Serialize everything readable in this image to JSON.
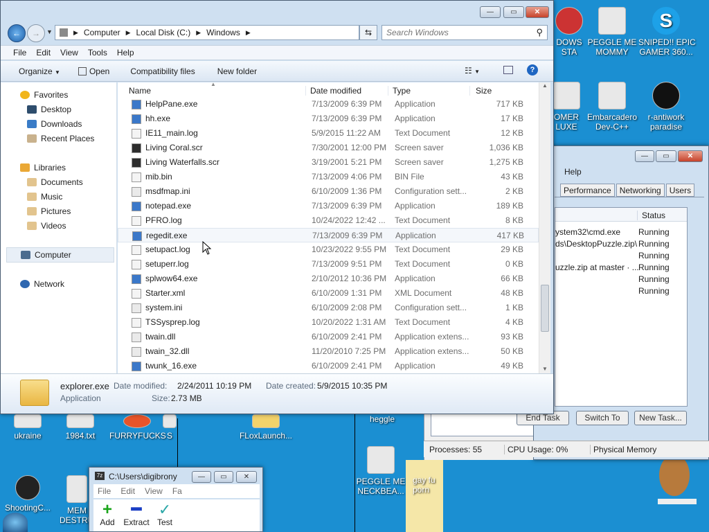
{
  "desktop": {
    "icons": [
      {
        "label": "DOWS\nSTA"
      },
      {
        "label": "PEGGLE ME\nMOMMY"
      },
      {
        "label": "SNIPED!! EPIC\nGAMER 360..."
      },
      {
        "label": "OMER\nLUXE"
      },
      {
        "label": "Embarcadero\nDev-C++"
      },
      {
        "label": "r-antiwork\nparadise"
      },
      {
        "label": "ukraine"
      },
      {
        "label": "1984.txt"
      },
      {
        "label": "FURRYFUCKS"
      },
      {
        "label": "S"
      },
      {
        "label": "FLoxLaunch..."
      },
      {
        "label": "heggle"
      },
      {
        "label": "PEGGLE ME\nNECKBEA..."
      },
      {
        "label": "gay fu\nporn"
      },
      {
        "label": "ShootingC..."
      },
      {
        "label": "MEM\nDESTRUC"
      }
    ]
  },
  "explorer": {
    "address": {
      "crumbs": [
        "Computer",
        "Local Disk (C:)",
        "Windows"
      ]
    },
    "search": {
      "placeholder": "Search Windows"
    },
    "menu": [
      "File",
      "Edit",
      "View",
      "Tools",
      "Help"
    ],
    "toolbar": {
      "organize": "Organize",
      "open": "Open",
      "compat": "Compatibility files",
      "newfolder": "New folder"
    },
    "nav": {
      "favorites": "Favorites",
      "desktop": "Desktop",
      "downloads": "Downloads",
      "recent": "Recent Places",
      "libraries": "Libraries",
      "documents": "Documents",
      "music": "Music",
      "pictures": "Pictures",
      "videos": "Videos",
      "computer": "Computer",
      "network": "Network"
    },
    "columns": {
      "name": "Name",
      "date": "Date modified",
      "type": "Type",
      "size": "Size"
    },
    "files": [
      {
        "name": "HelpPane.exe",
        "date": "7/13/2009 6:39 PM",
        "type": "Application",
        "size": "717 KB"
      },
      {
        "name": "hh.exe",
        "date": "7/13/2009 6:39 PM",
        "type": "Application",
        "size": "17 KB"
      },
      {
        "name": "IE11_main.log",
        "date": "5/9/2015 11:22 AM",
        "type": "Text Document",
        "size": "12 KB"
      },
      {
        "name": "Living Coral.scr",
        "date": "7/30/2001 12:00 PM",
        "type": "Screen saver",
        "size": "1,036 KB"
      },
      {
        "name": "Living Waterfalls.scr",
        "date": "3/19/2001 5:21 PM",
        "type": "Screen saver",
        "size": "1,275 KB"
      },
      {
        "name": "mib.bin",
        "date": "7/13/2009 4:06 PM",
        "type": "BIN File",
        "size": "43 KB"
      },
      {
        "name": "msdfmap.ini",
        "date": "6/10/2009 1:36 PM",
        "type": "Configuration sett...",
        "size": "2 KB"
      },
      {
        "name": "notepad.exe",
        "date": "7/13/2009 6:39 PM",
        "type": "Application",
        "size": "189 KB"
      },
      {
        "name": "PFRO.log",
        "date": "10/24/2022 12:42 ...",
        "type": "Text Document",
        "size": "8 KB"
      },
      {
        "name": "regedit.exe",
        "date": "7/13/2009 6:39 PM",
        "type": "Application",
        "size": "417 KB"
      },
      {
        "name": "setupact.log",
        "date": "10/23/2022 9:55 PM",
        "type": "Text Document",
        "size": "29 KB"
      },
      {
        "name": "setuperr.log",
        "date": "7/13/2009 9:51 PM",
        "type": "Text Document",
        "size": "0 KB"
      },
      {
        "name": "splwow64.exe",
        "date": "2/10/2012 10:36 PM",
        "type": "Application",
        "size": "66 KB"
      },
      {
        "name": "Starter.xml",
        "date": "6/10/2009 1:31 PM",
        "type": "XML Document",
        "size": "48 KB"
      },
      {
        "name": "system.ini",
        "date": "6/10/2009 2:08 PM",
        "type": "Configuration sett...",
        "size": "1 KB"
      },
      {
        "name": "TSSysprep.log",
        "date": "10/20/2022 1:31 AM",
        "type": "Text Document",
        "size": "4 KB"
      },
      {
        "name": "twain.dll",
        "date": "6/10/2009 2:41 PM",
        "type": "Application extens...",
        "size": "93 KB"
      },
      {
        "name": "twain_32.dll",
        "date": "11/20/2010 7:25 PM",
        "type": "Application extens...",
        "size": "50 KB"
      },
      {
        "name": "twunk_16.exe",
        "date": "6/10/2009 2:41 PM",
        "type": "Application",
        "size": "49 KB"
      }
    ],
    "details": {
      "name": "explorer.exe",
      "type": "Application",
      "modified_label": "Date modified:",
      "modified": "2/24/2011 10:19 PM",
      "created_label": "Date created:",
      "created": "5/9/2015 10:35 PM",
      "size_label": "Size:",
      "size": "2.73 MB"
    }
  },
  "taskmgr": {
    "menu_help": "Help",
    "tabs": [
      "Performance",
      "Networking",
      "Users"
    ],
    "status_header": "Status",
    "rows": [
      {
        "image": "ystem32\\cmd.exe",
        "status": "Running"
      },
      {
        "image": "ds\\DesktopPuzzle.zip\\",
        "status": "Running"
      },
      {
        "image": "",
        "status": "Running"
      },
      {
        "image": "uzzle.zip at master · ...",
        "status": "Running"
      },
      {
        "image": "",
        "status": "Running"
      },
      {
        "image": "",
        "status": "Running"
      }
    ],
    "end_task": "End Task",
    "switch_to": "Switch To",
    "new_task": "New Task...",
    "status_bar": {
      "processes": "Processes: 55",
      "cpu": "CPU Usage: 0%",
      "memory": "Physical Memory"
    }
  },
  "zip": {
    "title": "C:\\Users\\digibrony",
    "menu": [
      "File",
      "Edit",
      "View",
      "Fa"
    ],
    "buttons": {
      "add": "Add",
      "extract": "Extract",
      "test": "Test"
    }
  },
  "colors": {
    "desktop": "#1b8fd2",
    "selection": "#cce8ff",
    "frame": "#cfe0f1"
  }
}
